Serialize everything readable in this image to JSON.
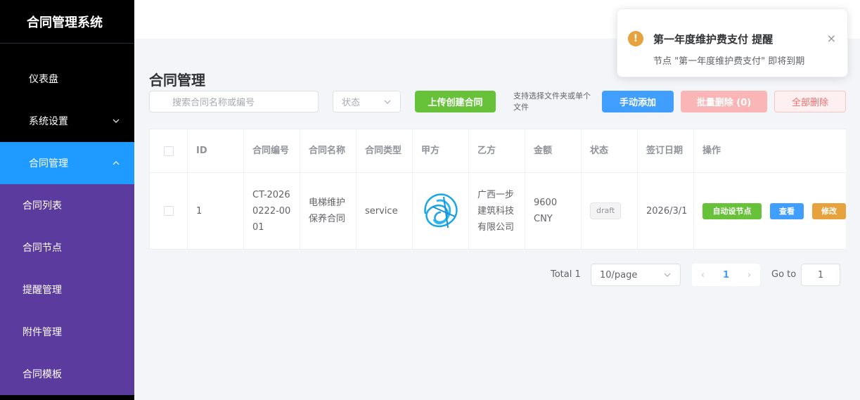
{
  "app": {
    "title": "合同管理系统"
  },
  "sidebar": {
    "items": [
      {
        "label": "仪表盘"
      },
      {
        "label": "系统设置"
      },
      {
        "label": "合同管理"
      }
    ],
    "subitems": [
      {
        "label": "合同列表"
      },
      {
        "label": "合同节点"
      },
      {
        "label": "提醒管理"
      },
      {
        "label": "附件管理"
      },
      {
        "label": "合同模板"
      }
    ]
  },
  "page": {
    "title": "合同管理"
  },
  "toolbar": {
    "search_placeholder": "搜索合同名称或编号",
    "status_placeholder": "状态",
    "upload_label": "上传创建合同",
    "upload_hint": "支持选择文件夹或单个文件",
    "manual_add_label": "手动添加",
    "batch_delete_label": "批量删除 (0)",
    "delete_all_label": "全部删除"
  },
  "table": {
    "headers": [
      "ID",
      "合同编号",
      "合同名称",
      "合同类型",
      "甲方",
      "乙方",
      "金额",
      "状态",
      "签订日期",
      "操作"
    ],
    "rows": [
      {
        "id": "1",
        "code": "CT-20260222-0001",
        "name": "电梯维护保养合同",
        "type": "service",
        "party_a": "",
        "party_b": "广西一步建筑科技有限公司",
        "amount": "9600 CNY",
        "status": "draft",
        "date": "2026/3/1",
        "actions": [
          "自动设节点",
          "查看",
          "修改"
        ]
      }
    ]
  },
  "pagination": {
    "total": "Total 1",
    "page_size": "10/page",
    "current": "1",
    "goto_label": "Go to",
    "goto_value": "1"
  },
  "notification": {
    "icon": "warning-icon",
    "title": "第一年度维护费支付 提醒",
    "body": "节点 \"第一年度维护费支付\" 即将到期"
  },
  "colors": {
    "sidebar_bg": "#000000",
    "submenu_bg": "#5b3b9e",
    "active_menu": "#1f9bff",
    "primary": "#409eff",
    "success": "#67c23a",
    "warning": "#e6a23c",
    "danger": "#f56c6c"
  }
}
